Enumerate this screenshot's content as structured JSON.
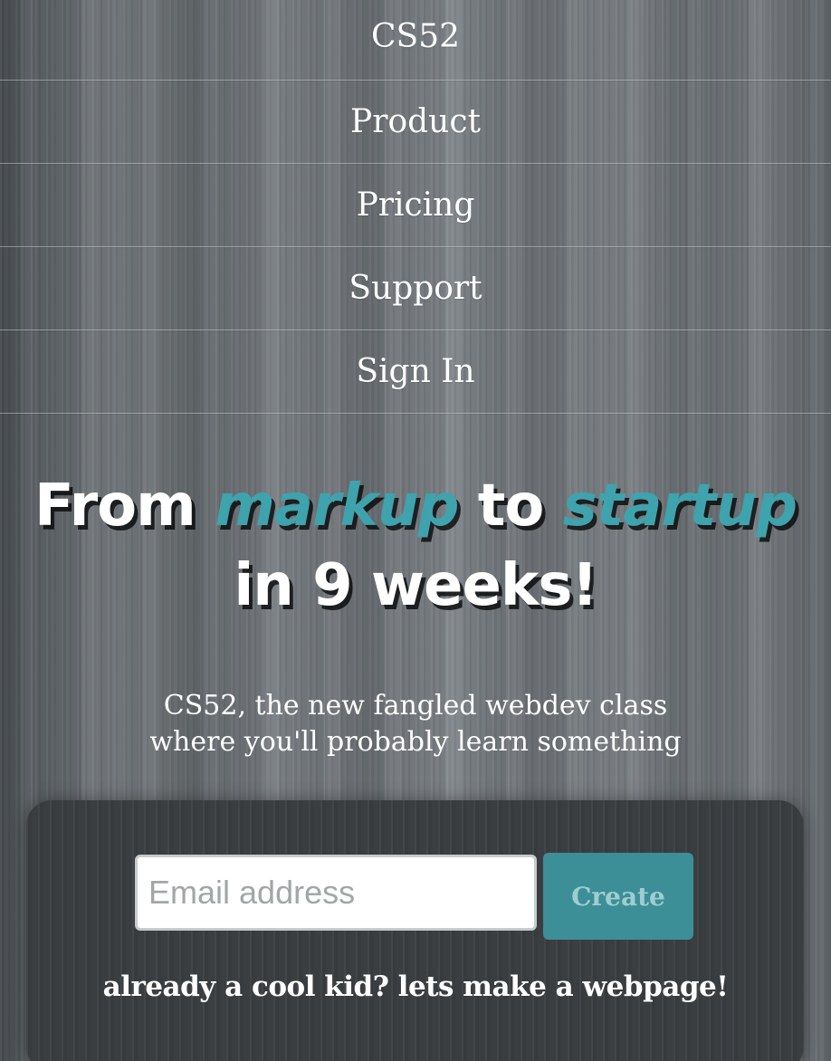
{
  "nav": {
    "brand": "CS52",
    "items": [
      {
        "label": "Product"
      },
      {
        "label": "Pricing"
      },
      {
        "label": "Support"
      },
      {
        "label": "Sign In"
      }
    ]
  },
  "hero": {
    "line1_word1": "From",
    "line1_accent1": "markup",
    "line1_word2": "to",
    "line1_accent2": "startup",
    "line2": "in 9 weeks!",
    "accent_color": "#3ea3ad"
  },
  "subtitle": {
    "line1": "CS52, the new fangled webdev class",
    "line2": "where you'll probably learn something"
  },
  "signup": {
    "email_placeholder": "Email address",
    "email_value": "",
    "create_label": "Create",
    "create_color": "#3d8f97",
    "footer_text": "already a cool kid? lets make a webpage!"
  }
}
